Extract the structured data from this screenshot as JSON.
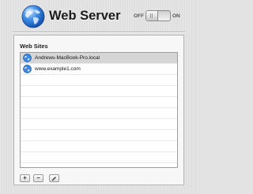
{
  "header": {
    "title": "Web Server",
    "toggle": {
      "off_label": "OFF",
      "on_label": "ON",
      "state": "off"
    }
  },
  "panel": {
    "label": "Web Sites",
    "sites": [
      {
        "name": "Andrews-MacBook-Pro.local",
        "selected": true
      },
      {
        "name": "www.example1.com",
        "selected": false
      }
    ],
    "buttons": [
      {
        "name": "add-site-button",
        "glyph": "+"
      },
      {
        "name": "remove-site-button",
        "glyph": "−"
      },
      {
        "name": "edit-site-button",
        "icon": "pencil-icon"
      }
    ]
  }
}
